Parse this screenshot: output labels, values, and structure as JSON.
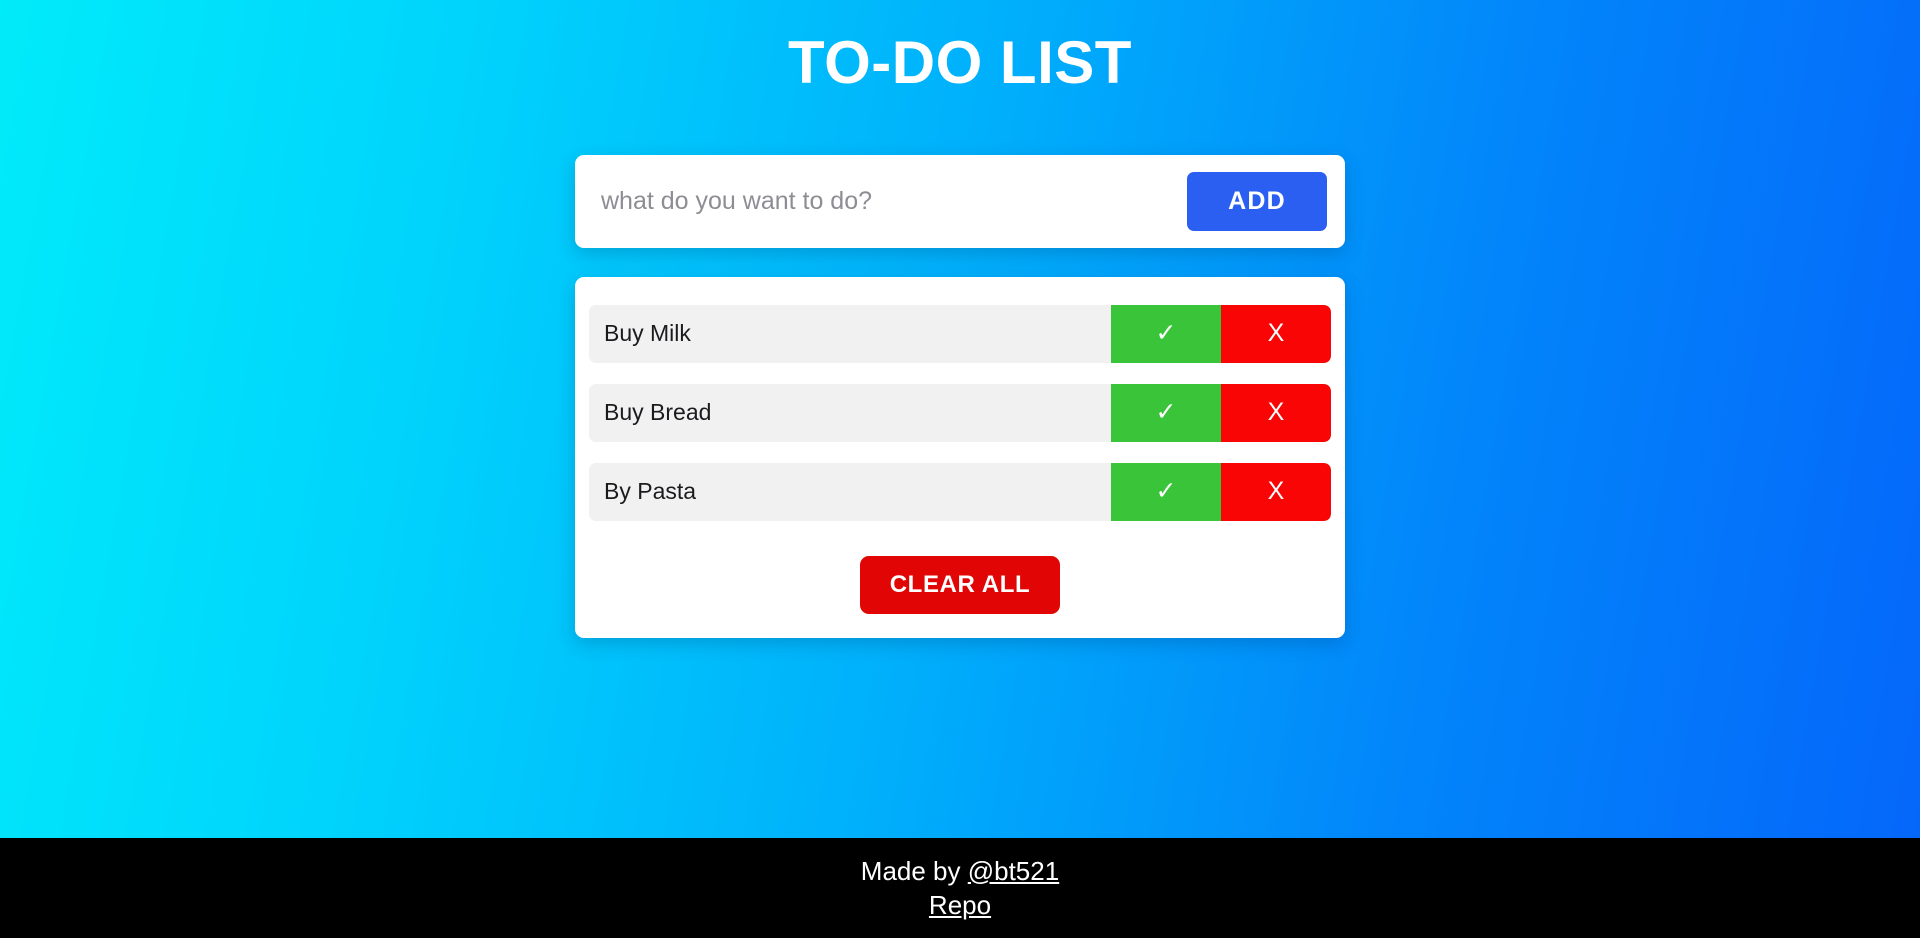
{
  "app": {
    "title": "TO-DO LIST",
    "background_gradient_from": "#00EBFA",
    "background_gradient_to": "#0566FA"
  },
  "input_bar": {
    "placeholder": "what do you want to do?",
    "value": "",
    "add_label": "ADD",
    "add_color": "#2B5FF2"
  },
  "todo_list": {
    "items": [
      {
        "label": "Buy Milk",
        "done_icon": "check-icon",
        "done_glyph": "✓",
        "delete_icon": "close-icon",
        "delete_glyph": "X"
      },
      {
        "label": "Buy Bread",
        "done_icon": "check-icon",
        "done_glyph": "✓",
        "delete_icon": "close-icon",
        "delete_glyph": "X"
      },
      {
        "label": "By Pasta",
        "done_icon": "check-icon",
        "done_glyph": "✓",
        "delete_icon": "close-icon",
        "delete_glyph": "X"
      }
    ],
    "done_color": "#3AC43A",
    "delete_color": "#FA0505",
    "row_background": "#f1f1f1",
    "clear_all_label": "CLEAR ALL",
    "clear_all_color": "#E20505"
  },
  "footer": {
    "made_by_prefix": "Made by ",
    "author_handle": "@bt521",
    "repo_label": "Repo",
    "background": "#000000"
  }
}
